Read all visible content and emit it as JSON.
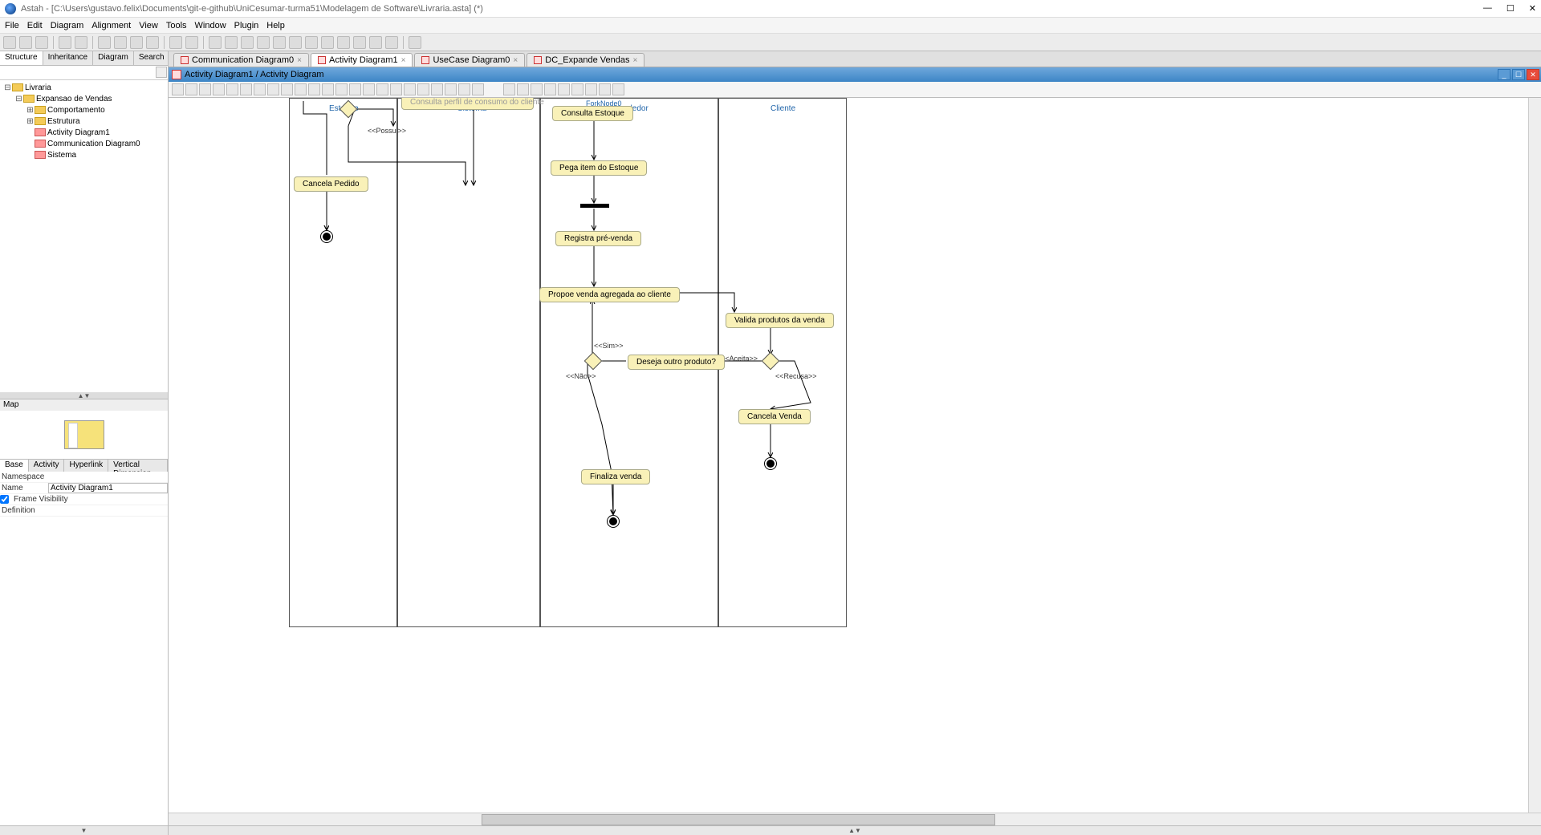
{
  "window": {
    "title": "Astah - [C:\\Users\\gustavo.felix\\Documents\\git-e-github\\UniCesumar-turma51\\Modelagem de Software\\Livraria.asta] (*)"
  },
  "menu": [
    "File",
    "Edit",
    "Diagram",
    "Alignment",
    "View",
    "Tools",
    "Window",
    "Plugin",
    "Help"
  ],
  "left_tabs": [
    "Structure",
    "Inheritance",
    "Diagram",
    "Search"
  ],
  "tree": {
    "root": "Livraria",
    "n1": "Expansao de Vendas",
    "n2": "Comportamento",
    "n3": "Estrutura",
    "n4": "Activity Diagram1",
    "n5": "Communication Diagram0",
    "n6": "Sistema"
  },
  "map_label": "Map",
  "prop_tabs": [
    "Base",
    "Activity",
    "Hyperlink",
    "Vertical Dimension"
  ],
  "props": {
    "namespace_l": "Namespace",
    "name_l": "Name",
    "name_v": "Activity Diagram1",
    "frame_l": "Frame Visibility",
    "def_l": "Definition"
  },
  "doc_tabs": [
    {
      "label": "Communication Diagram0"
    },
    {
      "label": "Activity Diagram1",
      "active": true
    },
    {
      "label": "UseCase Diagram0"
    },
    {
      "label": "DC_Expande Vendas"
    }
  ],
  "sub_title": "Activity Diagram1 / Activity Diagram",
  "lanes": {
    "estoque": "Estoque",
    "sistema": "Sistema",
    "vendedor": "Vendedor",
    "cliente": "Cliente",
    "forknode": "ForkNode0"
  },
  "activities": {
    "consulta_top": "Consulta perfil de consumo do cliente",
    "consulta_estoque": "Consulta Estoque",
    "pega_item": "Pega item do Estoque",
    "registra": "Registra pré-venda",
    "propoe": "Propoe venda agregada ao cliente",
    "valida": "Valida produtos da venda",
    "deseja": "Deseja outro produto?",
    "cancela_venda": "Cancela Venda",
    "cancela_pedido": "Cancela Pedido",
    "finaliza": "Finaliza venda"
  },
  "guards": {
    "possui": "<<Possui>>",
    "sim": "<<Sim>>",
    "nao": "<<Não>>",
    "aceita": "<<Aceita>>",
    "recusa": "<<Recusa>>"
  }
}
